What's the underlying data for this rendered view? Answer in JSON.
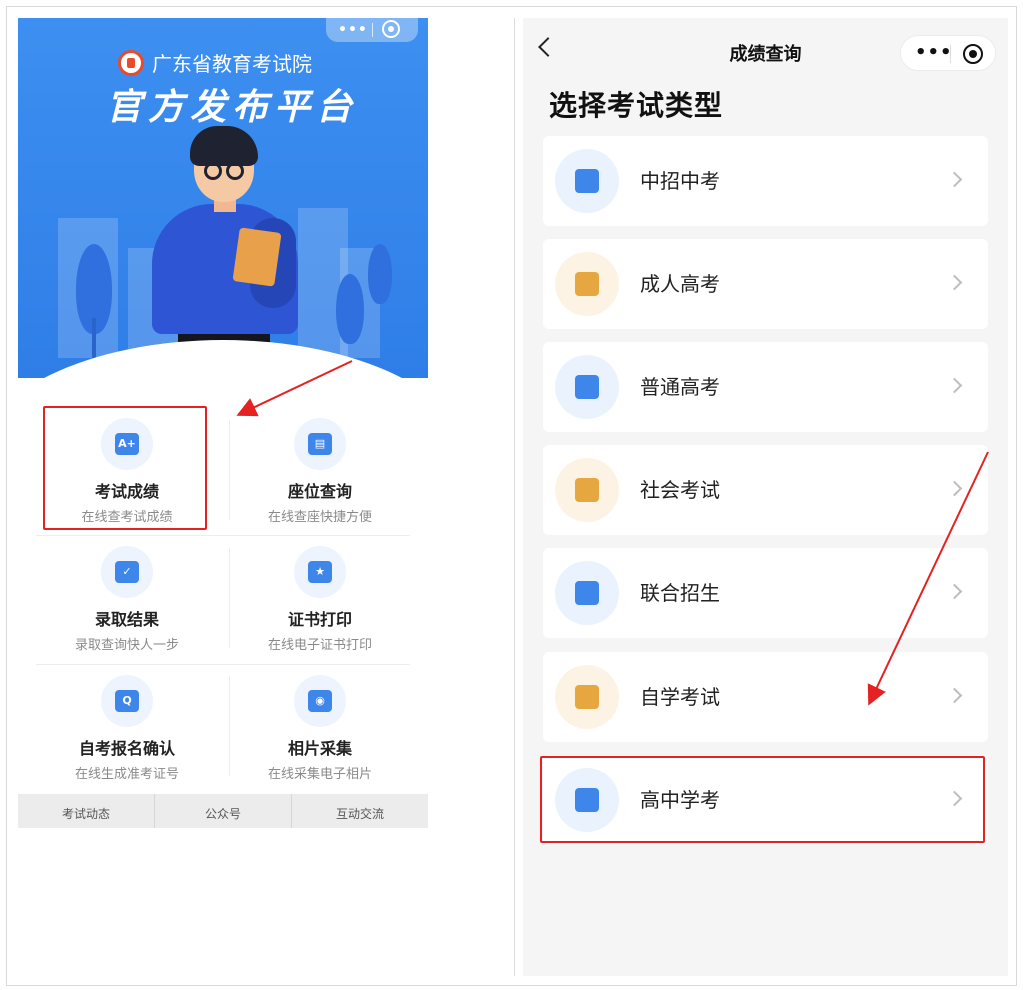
{
  "left_app": {
    "org_name": "广东省教育考试院",
    "platform_title": "官方发布平台",
    "menu": [
      {
        "title": "考试成绩",
        "subtitle": "在线查考试成绩",
        "icon": "exam-score-icon",
        "glyph": "A+"
      },
      {
        "title": "座位查询",
        "subtitle": "在线查座快捷方便",
        "icon": "seat-icon",
        "glyph": "▤"
      },
      {
        "title": "录取结果",
        "subtitle": "录取查询快人一步",
        "icon": "envelope-check-icon",
        "glyph": "✓"
      },
      {
        "title": "证书打印",
        "subtitle": "在线电子证书打印",
        "icon": "certificate-icon",
        "glyph": "★"
      },
      {
        "title": "自考报名确认",
        "subtitle": "在线生成准考证号",
        "icon": "search-doc-icon",
        "glyph": "Q"
      },
      {
        "title": "相片采集",
        "subtitle": "在线采集电子相片",
        "icon": "photo-capture-icon",
        "glyph": "◉"
      }
    ],
    "tabs": [
      "考试动态",
      "公众号",
      "互动交流"
    ]
  },
  "right_app": {
    "nav_title": "成绩查询",
    "heading": "选择考试类型",
    "items": [
      {
        "label": "中招中考",
        "icon": "school-icon",
        "bg": "#eaf2fd",
        "color": "#3f86ea"
      },
      {
        "label": "成人高考",
        "icon": "books-icon",
        "bg": "#fdf3e4",
        "color": "#e6a640"
      },
      {
        "label": "普通高考",
        "icon": "graduation-cap-icon",
        "bg": "#eaf2fd",
        "color": "#3f86ea"
      },
      {
        "label": "社会考试",
        "icon": "layers-icon",
        "bg": "#fdf3e4",
        "color": "#e6a640"
      },
      {
        "label": "联合招生",
        "icon": "scroll-icon",
        "bg": "#eaf2fd",
        "color": "#3f86ea"
      },
      {
        "label": "自学考试",
        "icon": "pencil-ruler-icon",
        "bg": "#fdf3e4",
        "color": "#e6a640"
      },
      {
        "label": "高中学考",
        "icon": "open-book-icon",
        "bg": "#eaf2fd",
        "color": "#3f86ea"
      }
    ]
  },
  "colors": {
    "accent_blue": "#3f86ea",
    "highlight_red": "#e42222"
  }
}
